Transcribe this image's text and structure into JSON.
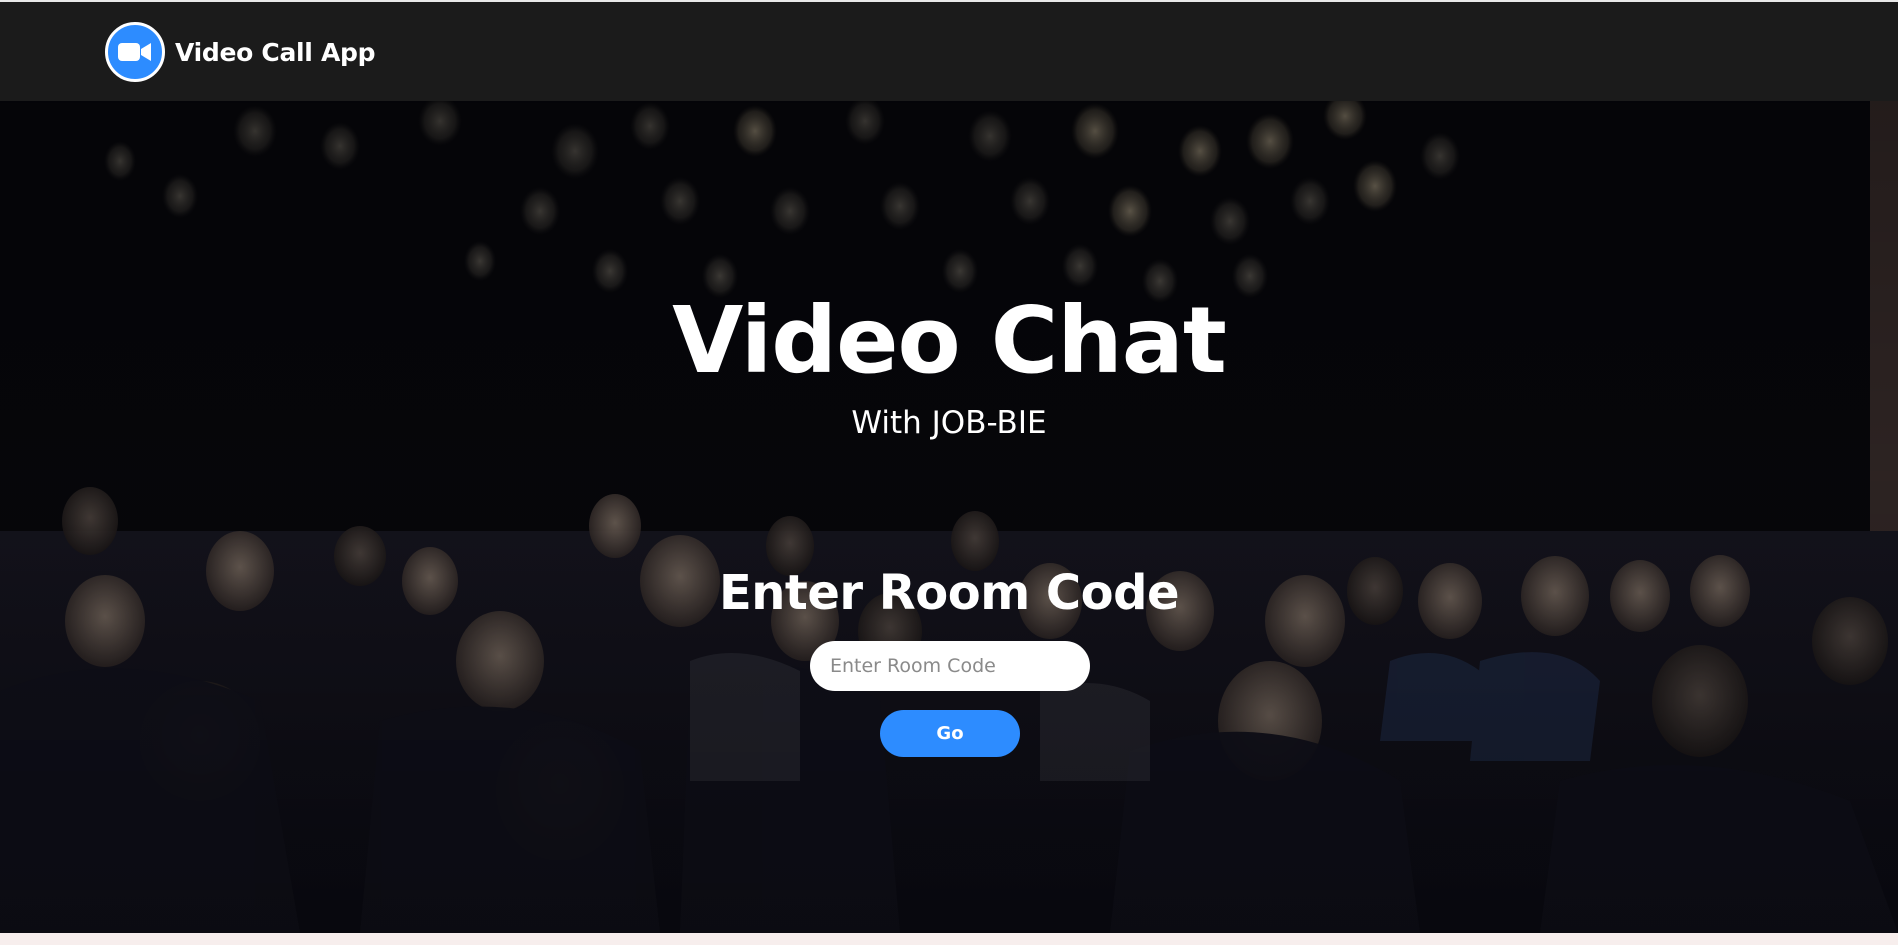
{
  "navbar": {
    "brand_name": "Video Call App",
    "logo_icon": "video-camera-icon"
  },
  "hero": {
    "title": "Video Chat",
    "subtitle": "With JOB-BIE",
    "background_image": "audience-at-conference"
  },
  "join": {
    "heading": "Enter Room Code",
    "input_placeholder": "Enter Room Code",
    "input_value": "",
    "go_label": "Go"
  },
  "colors": {
    "accent": "#2d8cff",
    "navbar_bg": "#1b1b1b",
    "hero_bg": "#050507"
  }
}
